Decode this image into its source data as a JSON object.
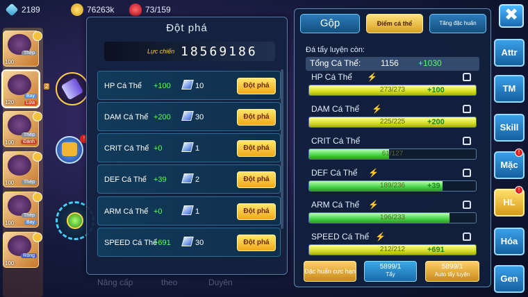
{
  "resources": {
    "gems": "2189",
    "gold": "76263k",
    "stamina": "73/159"
  },
  "roster": [
    {
      "level": "100",
      "tags": [
        "Thép",
        ""
      ]
    },
    {
      "level": "120",
      "tags": [
        "Bay",
        "Lửa"
      ]
    },
    {
      "level": "100",
      "tags": [
        "Thép",
        "Đánh"
      ]
    },
    {
      "level": "100",
      "tags": [
        "Thép",
        ""
      ]
    },
    {
      "level": "100",
      "tags": [
        "Thép",
        "Bay"
      ]
    },
    {
      "level": "100",
      "tags": [
        "Rồng",
        ""
      ]
    }
  ],
  "equip_level": "2",
  "breakthrough": {
    "title": "Đột phá",
    "power_label": "Lực chiến",
    "power_value": "18569186",
    "rows": [
      {
        "stat": "HP Cá Thể",
        "bonus": "+100",
        "qty": "10",
        "button": "Đột phá"
      },
      {
        "stat": "DAM Cá Thể",
        "bonus": "+200",
        "qty": "30",
        "button": "Đột phá"
      },
      {
        "stat": "CRIT Cá Thể",
        "bonus": "+0",
        "qty": "1",
        "button": "Đột phá"
      },
      {
        "stat": "DEF Cá Thể",
        "bonus": "+39",
        "qty": "2",
        "button": "Đột phá"
      },
      {
        "stat": "ARM Cá Thể",
        "bonus": "+0",
        "qty": "1",
        "button": "Đột phá"
      },
      {
        "stat": "SPEED Cá Thể",
        "bonus": "+691",
        "qty": "30",
        "button": "Đột phá"
      }
    ],
    "background_labels": [
      "Nâng cấp",
      "theo",
      "Duyên"
    ]
  },
  "stats_panel": {
    "tabs": {
      "merge": "Gộp",
      "individual_points": "Điểm cá thể",
      "special_training": "Tăng đặc huấn"
    },
    "remaining_label": "Đá tẩy luyện còn:",
    "total_label": "Tổng Cá Thể:",
    "total_value": "1156",
    "total_bonus": "+1030",
    "stats": [
      {
        "name": "HP Cá Thể",
        "bar_text": "273/273",
        "fill": 1.0,
        "bonus": "+100",
        "color": "yellow",
        "bolt": true
      },
      {
        "name": "DAM Cá Thể",
        "bar_text": "225/225",
        "fill": 1.0,
        "bonus": "+200",
        "color": "yellow",
        "bolt": true
      },
      {
        "name": "CRIT Cá Thể",
        "bar_text": "61/127",
        "fill": 0.48,
        "bonus": "",
        "color": "green",
        "bolt": false
      },
      {
        "name": "DEF Cá Thể",
        "bar_text": "189/236",
        "fill": 0.8,
        "bonus": "+39",
        "color": "green",
        "bolt": true
      },
      {
        "name": "ARM Cá Thể",
        "bar_text": "196/233",
        "fill": 0.84,
        "bonus": "",
        "color": "green",
        "bolt": true
      },
      {
        "name": "SPEED Cá Thể",
        "bar_text": "212/212",
        "fill": 1.0,
        "bonus": "+691",
        "color": "yellow",
        "bolt": true
      }
    ],
    "actions": {
      "extreme_training": "Đặc huấn cực hạn",
      "wash_count": "5899/1",
      "wash_label": "Tẩy",
      "auto_count": "5899/1",
      "auto_label": "Auto tẩy luyện"
    }
  },
  "side_nav": {
    "close": "✖",
    "items": [
      "Attr",
      "TM",
      "Skill",
      "Mặc",
      "HL",
      "Hóa",
      "Gen"
    ],
    "badges": [
      "",
      "",
      "",
      "!",
      "!",
      "",
      ""
    ],
    "active": "HL"
  }
}
